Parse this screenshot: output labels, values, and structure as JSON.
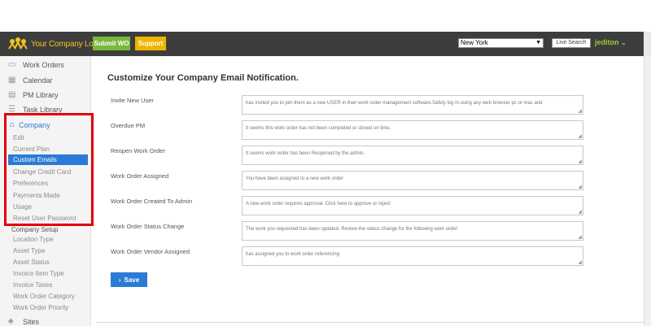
{
  "header": {
    "logo_text": "Your Company Logo Here",
    "submit_wo": "Submit WO",
    "support": "Support",
    "location": "New York",
    "live_search": "Live Search",
    "username": "jediton",
    "user_chevron": "❯",
    "logo_color": "#f2c31c",
    "bar_color": "#3d3d3d"
  },
  "sidebar": {
    "main_items": [
      {
        "label": "Work Orders",
        "icon": "folder-icon"
      },
      {
        "label": "Calendar",
        "icon": "calendar-icon"
      },
      {
        "label": "PM Library",
        "icon": "book-icon"
      },
      {
        "label": "Task Library",
        "icon": "list-icon"
      }
    ],
    "company": "Company",
    "company_items": [
      "Edit",
      "Current Plan",
      "Custom Emails",
      "Change Credit Card",
      "Preferences",
      "Payments Made",
      "Usage",
      "Reset User Password"
    ],
    "active_item": "Custom Emails",
    "setup_head": "Company Setup",
    "setup_items": [
      "Location Type",
      "Asset Type",
      "Asset Status",
      "Invoice Item Type",
      "Invoice Taxes",
      "Work Order Category",
      "Work Order Priority"
    ],
    "sites": "Sites",
    "highlight_color": "#e0000c",
    "accent_color": "#2a7bd5"
  },
  "main": {
    "title": "Customize Your Company Email Notification.",
    "rows": [
      {
        "label": "Invite New User",
        "value": "has invited you to join them as a new USER in their work order management software.Safely log in using any web browser pc or mac and"
      },
      {
        "label": "Overdue PM",
        "value": "It seems this work order has not been completed or closed on time."
      },
      {
        "label": "Reopen Work Order",
        "value": "It seems work order has been Reopened by the admin."
      },
      {
        "label": "Work Order Assigned",
        "value": "You have been assigned to a new work order"
      },
      {
        "label": "Work Order Created To Admin",
        "value": "A new work order requires approval. Click here to approve or reject"
      },
      {
        "label": "Work Order Status Change",
        "value": "The work you requested has been updated. Review the status change for the following work order:"
      },
      {
        "label": "Work Order Vendor Assigned",
        "value": "has assigned you to work order referencing"
      }
    ],
    "save": "Save"
  }
}
